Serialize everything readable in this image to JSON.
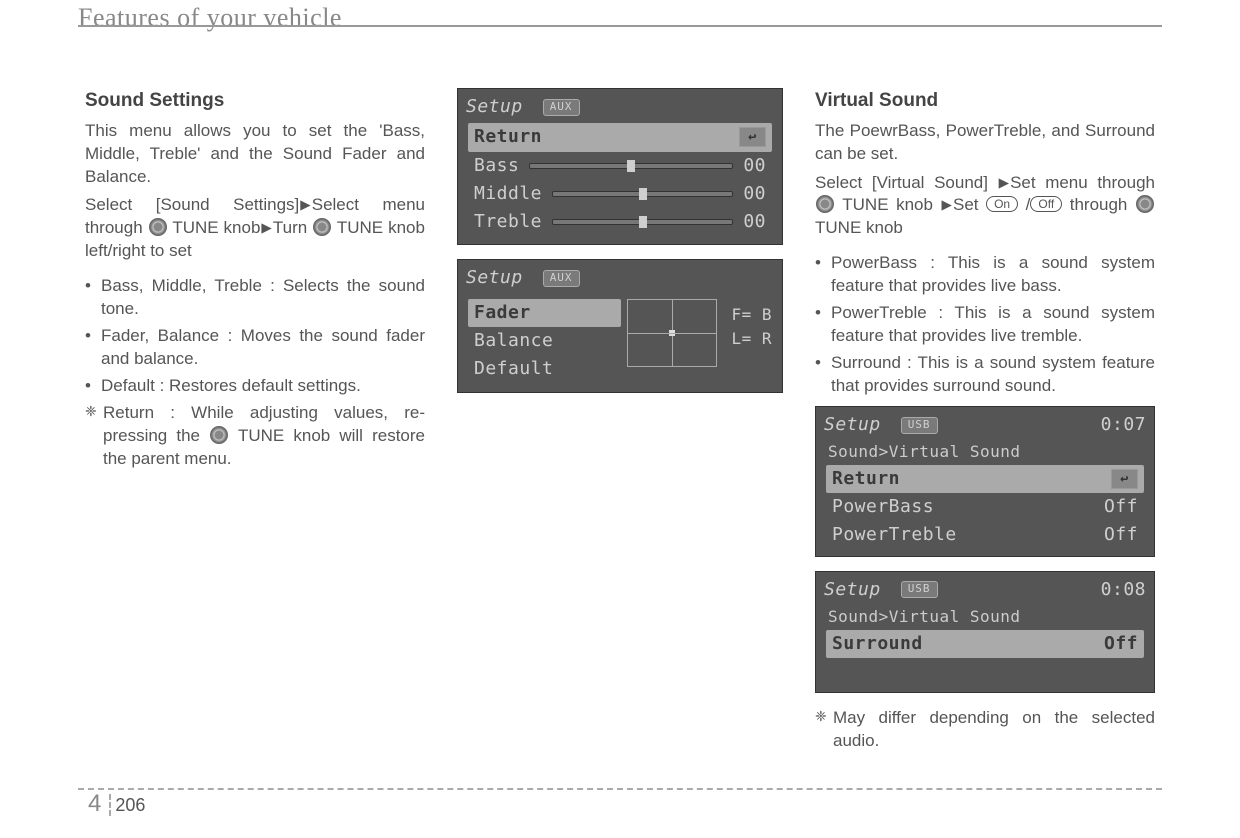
{
  "header": "Features of your vehicle",
  "footer": {
    "chapter": "4",
    "page": "206"
  },
  "col1": {
    "heading": "Sound Settings",
    "intro": "This menu allows you to set the 'Bass, Middle, Treble' and the Sound Fader and Balance.",
    "select_lead": "Select [Sound Settings]",
    "select_mid": "Select menu through",
    "select_tune": "TUNE knob",
    "select_turn": "Turn",
    "select_tail": "TUNE knob left/right to set",
    "b1": "Bass, Middle, Treble : Selects the sound tone.",
    "b2": "Fader, Balance : Moves the sound fader and balance.",
    "b3": "Default : Restores default settings.",
    "note_lead": "Return : While adjusting values, re-pressing the ",
    "note_tail": " TUNE knob will restore the parent menu."
  },
  "shot_eq": {
    "title": "Setup",
    "badge": "AUX",
    "return": "Return",
    "rows": [
      {
        "label": "Bass",
        "val": "00"
      },
      {
        "label": "Middle",
        "val": "00"
      },
      {
        "label": "Treble",
        "val": "00"
      }
    ]
  },
  "shot_fader": {
    "title": "Setup",
    "badge": "AUX",
    "items": [
      "Fader",
      "Balance",
      "Default"
    ],
    "f_val": "F= B",
    "l_val": "L= R"
  },
  "col3": {
    "heading": "Virtual Sound",
    "intro": "The PoewrBass, PowerTreble, and Surround can be set.",
    "sel_a": "Select [Virtual Sound]",
    "sel_b": "Set menu through",
    "sel_c": "TUNE knob",
    "sel_d": "Set",
    "on": "On",
    "off": "Off",
    "sel_e": "through",
    "sel_f": "TUNE knob",
    "b1": "PowerBass : This is a sound system feature that provides live bass.",
    "b2": "PowerTreble : This is a sound system feature that provides live tremble.",
    "b3": "Surround : This is a sound system feature that provides surround sound.",
    "footnote": "May differ depending on the selected audio."
  },
  "shot_vs1": {
    "title": "Setup",
    "badge": "USB",
    "time": "0:07",
    "crumb": "Sound>Virtual Sound",
    "return": "Return",
    "r1": "PowerBass",
    "r1v": "Off",
    "r2": "PowerTreble",
    "r2v": "Off"
  },
  "shot_vs2": {
    "title": "Setup",
    "badge": "USB",
    "time": "0:08",
    "crumb": "Sound>Virtual Sound",
    "r1": "Surround",
    "r1v": "Off"
  }
}
